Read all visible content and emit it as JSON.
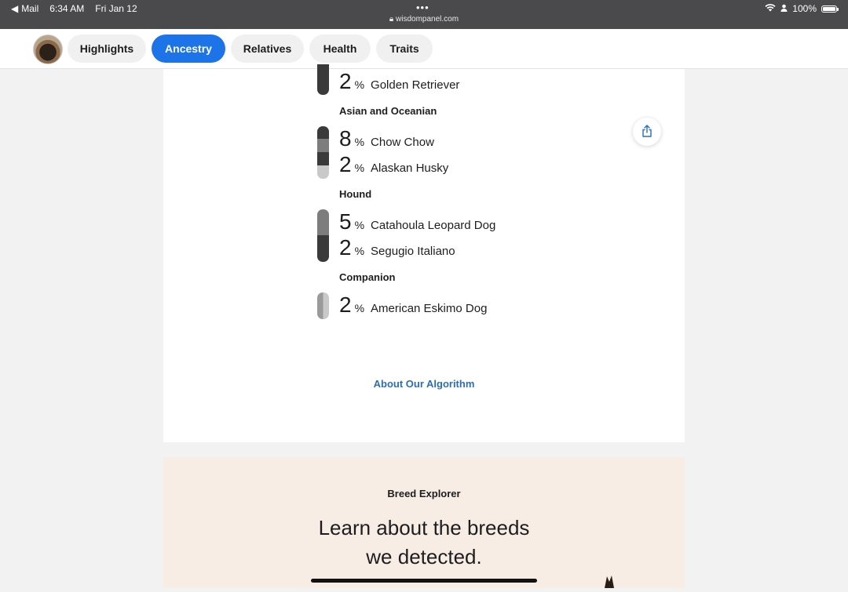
{
  "status_bar": {
    "back_app": "Mail",
    "time": "6:34 AM",
    "date": "Fri Jan 12",
    "url": "wisdompanel.com",
    "battery": "100%"
  },
  "tabs": [
    {
      "label": "Highlights",
      "active": false
    },
    {
      "label": "Ancestry",
      "active": true
    },
    {
      "label": "Relatives",
      "active": false
    },
    {
      "label": "Health",
      "active": false
    },
    {
      "label": "Traits",
      "active": false
    }
  ],
  "ancestry": {
    "top_row": {
      "value": "2",
      "unit": "%",
      "breed": "Golden Retriever"
    },
    "groups": [
      {
        "name": "Asian and Oceanian",
        "rows": [
          {
            "value": "8",
            "unit": "%",
            "breed": "Chow Chow"
          },
          {
            "value": "2",
            "unit": "%",
            "breed": "Alaskan Husky"
          }
        ]
      },
      {
        "name": "Hound",
        "rows": [
          {
            "value": "5",
            "unit": "%",
            "breed": "Catahoula Leopard Dog"
          },
          {
            "value": "2",
            "unit": "%",
            "breed": "Segugio Italiano"
          }
        ]
      },
      {
        "name": "Companion",
        "rows": [
          {
            "value": "2",
            "unit": "%",
            "breed": "American Eskimo Dog"
          }
        ]
      }
    ],
    "about_link": "About Our Algorithm"
  },
  "breed_explorer": {
    "label": "Breed Explorer",
    "title_line1": "Learn about the breeds",
    "title_line2": "we detected."
  },
  "colors": {
    "accent": "#1c74e8",
    "link": "#2a6fb4",
    "explorer_bg": "#f7ede4",
    "bar_dark": "#3a3a3a",
    "bar_mid": "#7d7d7d",
    "bar_light": "#c9c9c9"
  }
}
